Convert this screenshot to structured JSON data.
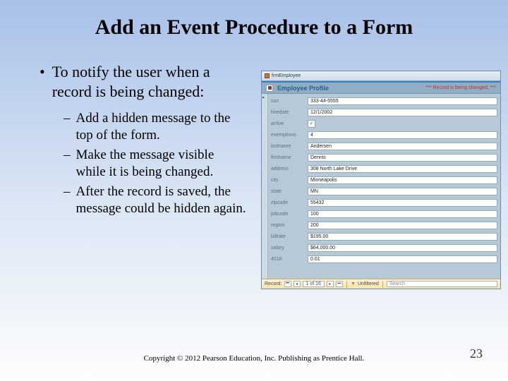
{
  "title": "Add an Event Procedure to a Form",
  "bullet": "To notify the user when a record is being changed:",
  "subs": [
    "Add a hidden message to the top of the form.",
    "Make the message visible while it is being changed.",
    "After the record is saved, the message could be hidden again."
  ],
  "copyright": "Copyright © 2012 Pearson Education, Inc. Publishing as Prentice Hall.",
  "page_number": "23",
  "screenshot": {
    "tab_label": "frmEmployee",
    "form_title": "Employee Profile",
    "warning": "*** Record is being changed. ***",
    "nav": {
      "record_label": "Record:",
      "position": "1 of 16",
      "filter_label": "Unfiltered",
      "search_placeholder": "Search"
    },
    "fields": [
      {
        "label": "ssn",
        "value": "333-44-5555",
        "type": "text"
      },
      {
        "label": "hiredate",
        "value": "12/1/2002",
        "type": "text"
      },
      {
        "label": "active",
        "value": "✓",
        "type": "check"
      },
      {
        "label": "exemptions",
        "value": "4",
        "type": "text"
      },
      {
        "label": "lastname",
        "value": "Andersen",
        "type": "text"
      },
      {
        "label": "firstname",
        "value": "Dennis",
        "type": "text"
      },
      {
        "label": "address",
        "value": "308 North Lake Drive",
        "type": "text"
      },
      {
        "label": "city",
        "value": "Minneapolis",
        "type": "text"
      },
      {
        "label": "state",
        "value": "MN",
        "type": "text"
      },
      {
        "label": "zipcode",
        "value": "55432",
        "type": "text"
      },
      {
        "label": "jobcode",
        "value": "100",
        "type": "text"
      },
      {
        "label": "region",
        "value": "200",
        "type": "text"
      },
      {
        "label": "billrate",
        "value": "$195.00",
        "type": "text"
      },
      {
        "label": "salary",
        "value": "$64,000.00",
        "type": "text"
      },
      {
        "label": "401K",
        "value": "0.01",
        "type": "text"
      }
    ]
  }
}
